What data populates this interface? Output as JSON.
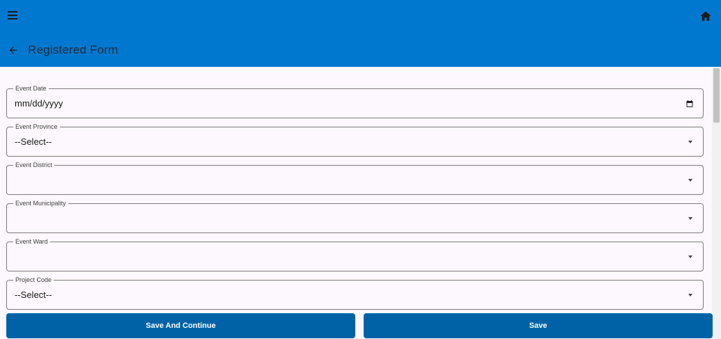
{
  "header": {
    "title": "Registered Form",
    "menu_icon": "menu-icon",
    "home_icon": "home-icon",
    "back_icon": "back-arrow-icon",
    "bar_color": "#0078cf"
  },
  "form": {
    "fields": [
      {
        "label": "Event Date",
        "value": "mm/dd/yyyy",
        "type": "date"
      },
      {
        "label": "Event Province",
        "value": "--Select--",
        "type": "select"
      },
      {
        "label": "Event District",
        "value": "",
        "type": "select"
      },
      {
        "label": "Event Municipality",
        "value": "",
        "type": "select"
      },
      {
        "label": "Event Ward",
        "value": "",
        "type": "select"
      },
      {
        "label": "Project Code",
        "value": "--Select--",
        "type": "select"
      }
    ]
  },
  "actions": {
    "save_and_continue_label": "Save And Continue",
    "save_label": "Save",
    "button_color": "#0062a6"
  }
}
